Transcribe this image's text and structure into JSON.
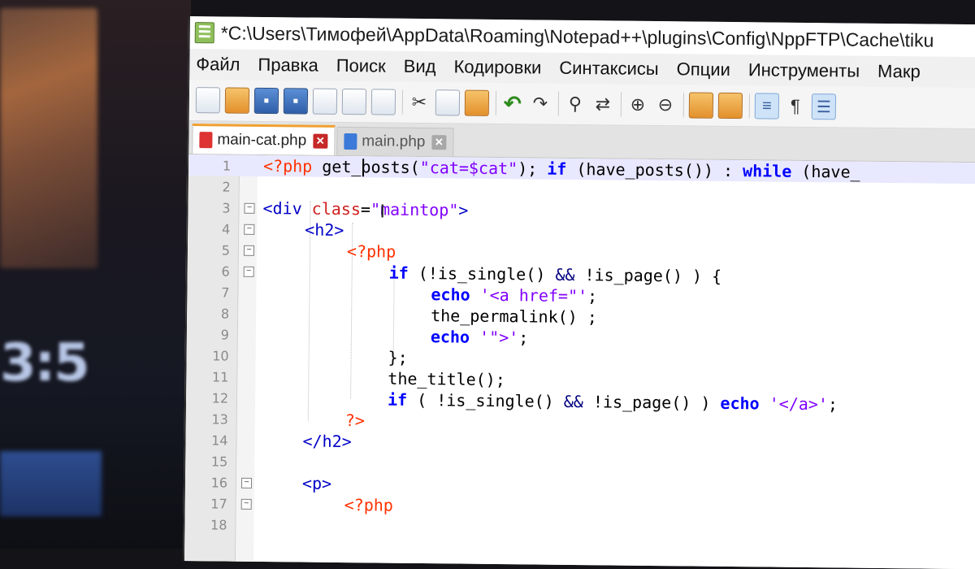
{
  "window": {
    "title": "*C:\\Users\\Тимофей\\AppData\\Roaming\\Notepad++\\plugins\\Config\\NppFTP\\Cache\\tiku"
  },
  "menu": [
    "Файл",
    "Правка",
    "Поиск",
    "Вид",
    "Кодировки",
    "Синтаксисы",
    "Опции",
    "Инструменты",
    "Макр"
  ],
  "toolbar": {
    "icons": [
      "new-file-icon",
      "open-file-icon",
      "save-icon",
      "save-all-icon",
      "close-icon",
      "close-all-icon",
      "print-icon",
      "cut-icon",
      "copy-icon",
      "paste-icon",
      "undo-icon",
      "redo-icon",
      "find-icon",
      "replace-icon",
      "zoom-in-icon",
      "zoom-out-icon",
      "sync-vertical-icon",
      "sync-horizontal-icon",
      "word-wrap-icon",
      "show-all-chars-icon",
      "indent-guide-icon"
    ]
  },
  "tabs": [
    {
      "label": "main-cat.php",
      "active": true
    },
    {
      "label": "main.php",
      "active": false
    }
  ],
  "editor": {
    "lines": [
      {
        "n": "1",
        "text": "<?php get_posts(\"cat=$cat\"); if (have_posts()) : while (have_"
      },
      {
        "n": "2",
        "text": ""
      },
      {
        "n": "3",
        "text": "<div class=\"maintop\">"
      },
      {
        "n": "4",
        "text": "<h2>"
      },
      {
        "n": "5",
        "text": "<?php"
      },
      {
        "n": "6",
        "text": "if (!is_single() && !is_page() ) {"
      },
      {
        "n": "7",
        "text": "echo '<a href=\"';"
      },
      {
        "n": "8",
        "text": "the_permalink() ;"
      },
      {
        "n": "9",
        "text": "echo '\">';"
      },
      {
        "n": "10",
        "text": "};"
      },
      {
        "n": "11",
        "text": "the_title();"
      },
      {
        "n": "12",
        "text": "if ( !is_single() && !is_page() ) echo '</a>';"
      },
      {
        "n": "13",
        "text": "?>"
      },
      {
        "n": "14",
        "text": "</h2>"
      },
      {
        "n": "15",
        "text": ""
      },
      {
        "n": "16",
        "text": "<p>"
      },
      {
        "n": "17",
        "text": "<?php"
      },
      {
        "n": "18",
        "text": ""
      }
    ]
  },
  "colors": {
    "keyword": "#0000ff",
    "tag": "#0000c8",
    "attribute": "#d02020",
    "string": "#8000ff",
    "php_tag": "#ff3000",
    "current_line": "#e8e8ff"
  }
}
